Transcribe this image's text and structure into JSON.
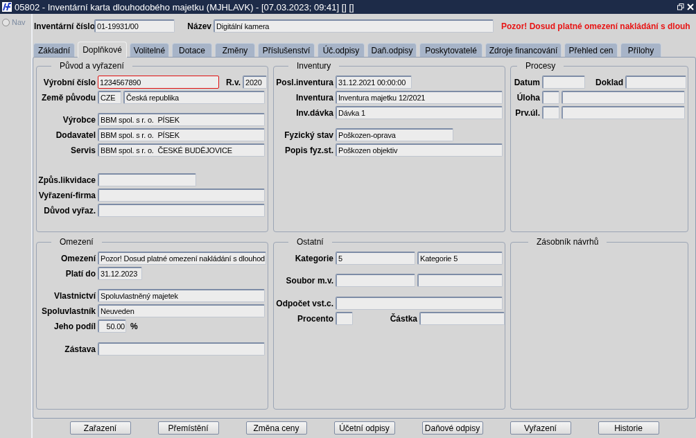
{
  "window": {
    "title": "05802 - Inventární karta dlouhodobého majetku (MJHLAVK) - [07.03.2023; 09:41] [] []"
  },
  "nav": {
    "label": "Nav",
    "checked": false
  },
  "header": {
    "fields": [
      {
        "label": "Inventární číslo",
        "value": "01-19931/00"
      },
      {
        "label": "Název",
        "value": "Digitální kamera"
      }
    ],
    "warning": "Pozor! Dosud platné omezení nakládání s dlouh"
  },
  "tabs": [
    {
      "label": "Základní",
      "selected": false
    },
    {
      "label": "Doplňkové",
      "selected": true
    },
    {
      "label": "Volitelné",
      "selected": false
    },
    {
      "label": "Dotace",
      "selected": false
    },
    {
      "label": "Změny",
      "selected": false
    },
    {
      "label": "Příslušenství",
      "selected": false
    },
    {
      "label": "Úč.odpisy",
      "selected": false
    },
    {
      "label": "Daň.odpisy",
      "selected": false
    },
    {
      "label": "Poskytovatelé",
      "selected": false
    },
    {
      "label": "Zdroje financování",
      "selected": false
    },
    {
      "label": "Přehled cen",
      "selected": false
    },
    {
      "label": "Přílohy",
      "selected": false
    }
  ],
  "panels": [
    {
      "title": "Původ a vyřazení",
      "rows": [
        {
          "label": "Výrobní číslo",
          "fields": [
            {
              "kind": "input",
              "value": "1234567890",
              "error": true
            },
            {
              "kind": "label",
              "text": "R.v."
            },
            {
              "kind": "input",
              "value": "2020",
              "error": false
            }
          ]
        },
        {
          "label": "Země původu",
          "fields": [
            {
              "kind": "input",
              "value": "CZE",
              "error": false
            },
            {
              "kind": "input",
              "value": "Česká republika",
              "error": false
            }
          ]
        },
        {
          "label": "Výrobce",
          "fields": [
            {
              "kind": "input",
              "value": "BBM spol. s r. o.  PÍSEK",
              "error": false
            }
          ]
        },
        {
          "label": "Dodavatel",
          "fields": [
            {
              "kind": "input",
              "value": "BBM spol. s r. o.  PÍSEK",
              "error": false
            }
          ]
        },
        {
          "label": "Servis",
          "fields": [
            {
              "kind": "input",
              "value": "BBM spol. s r. o.  ČESKÉ BUDĚJOVICE",
              "error": false
            }
          ]
        },
        {
          "label": "Způs.likvidace",
          "fields": [
            {
              "kind": "input",
              "error": false
            }
          ]
        },
        {
          "label": "Vyřazení-firma",
          "fields": [
            {
              "kind": "input",
              "error": false
            }
          ]
        },
        {
          "label": "Důvod vyřaz.",
          "fields": [
            {
              "kind": "input",
              "error": false
            }
          ]
        }
      ]
    },
    {
      "title": "Inventury",
      "rows": [
        {
          "label": "Posl.inventura",
          "fields": [
            {
              "kind": "input",
              "value": "31.12.2021 00:00:00",
              "error": false
            }
          ]
        },
        {
          "label": "Inventura",
          "fields": [
            {
              "kind": "input",
              "value": "Inventura majetku 12/2021",
              "error": false
            }
          ]
        },
        {
          "label": "Inv.dávka",
          "fields": [
            {
              "kind": "input",
              "value": "Dávka 1",
              "error": false
            }
          ]
        },
        {
          "label": "Fyzický stav",
          "fields": [
            {
              "kind": "input",
              "value": "Poškozen-oprava",
              "error": false
            }
          ]
        },
        {
          "label": "Popis fyz.st.",
          "fields": [
            {
              "kind": "input",
              "value": "Poškozen objektiv",
              "error": false
            }
          ]
        }
      ]
    },
    {
      "title": "Procesy",
      "rows": [
        {
          "label": "Datum",
          "fields": [
            {
              "kind": "input",
              "error": false
            },
            {
              "kind": "label",
              "text": "Doklad"
            },
            {
              "kind": "input",
              "error": false
            }
          ]
        },
        {
          "label": "Úloha",
          "fields": [
            {
              "kind": "input",
              "error": false
            },
            {
              "kind": "input",
              "error": false
            }
          ]
        },
        {
          "label": "Prv.úl.",
          "fields": [
            {
              "kind": "input",
              "error": false
            },
            {
              "kind": "input",
              "error": false
            }
          ]
        }
      ]
    },
    {
      "title": "Omezení",
      "rows": [
        {
          "label": "Omezení",
          "fields": [
            {
              "kind": "input",
              "value": "Pozor! Dosud platné omezení nakládání s dlouhod",
              "error": false
            }
          ]
        },
        {
          "label": "Platí do",
          "fields": [
            {
              "kind": "input",
              "value": "31.12.2023",
              "error": false
            }
          ]
        },
        {
          "label": "Vlastnictví",
          "fields": [
            {
              "kind": "input",
              "value": "Spoluvlastněný majetek",
              "error": false
            }
          ]
        },
        {
          "label": "Spoluvlastník",
          "fields": [
            {
              "kind": "input",
              "value": "Neuveden",
              "error": false
            }
          ]
        },
        {
          "label": "Jeho podíl",
          "fields": [
            {
              "kind": "input",
              "value": "50.00",
              "numeric": true,
              "error": false
            },
            {
              "kind": "unit",
              "text": "%"
            }
          ]
        },
        {
          "label": "Zástava",
          "fields": [
            {
              "kind": "input",
              "error": false
            }
          ]
        }
      ]
    },
    {
      "title": "Ostatní",
      "rows": [
        {
          "label": "Kategorie",
          "fields": [
            {
              "kind": "input",
              "value": "5",
              "error": false
            },
            {
              "kind": "input",
              "value": "Kategorie 5",
              "error": false
            }
          ]
        },
        {
          "label": "Soubor m.v.",
          "fields": [
            {
              "kind": "input",
              "error": false
            },
            {
              "kind": "input",
              "error": false
            }
          ]
        },
        {
          "label": "Odpočet vst.c.",
          "fields": [
            {
              "kind": "input",
              "error": false
            }
          ]
        },
        {
          "label": "Procento",
          "fields": [
            {
              "kind": "input",
              "error": false
            },
            {
              "kind": "label",
              "text": "Částka"
            },
            {
              "kind": "input",
              "error": false
            }
          ]
        }
      ]
    },
    {
      "title": "Zásobník návrhů"
    }
  ],
  "buttons": [
    "Zařazení",
    "Přemístění",
    "Změna ceny",
    "Účetní odpisy",
    "Daňové odpisy",
    "Vyřazení",
    "Historie"
  ]
}
